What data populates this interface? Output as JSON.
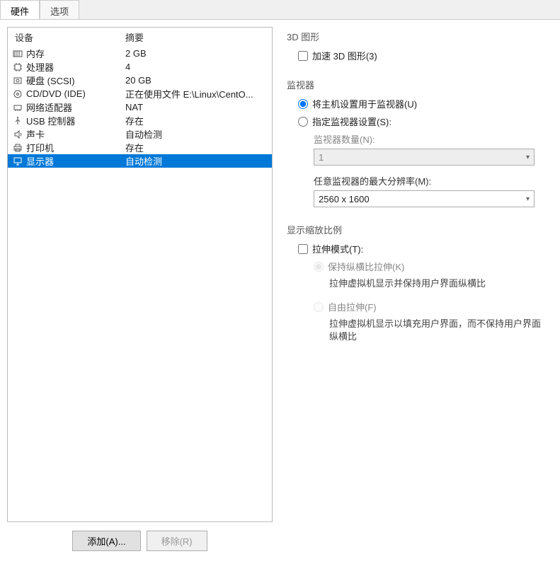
{
  "tabs": {
    "hardware": "硬件",
    "options": "选项"
  },
  "headers": {
    "device": "设备",
    "summary": "摘要"
  },
  "devices": [
    {
      "name": "内存",
      "summary": "2 GB"
    },
    {
      "name": "处理器",
      "summary": "4"
    },
    {
      "name": "硬盘 (SCSI)",
      "summary": "20 GB"
    },
    {
      "name": "CD/DVD (IDE)",
      "summary": "正在使用文件 E:\\Linux\\CentO..."
    },
    {
      "name": "网络适配器",
      "summary": "NAT"
    },
    {
      "name": "USB 控制器",
      "summary": "存在"
    },
    {
      "name": "声卡",
      "summary": "自动检测"
    },
    {
      "name": "打印机",
      "summary": "存在"
    },
    {
      "name": "显示器",
      "summary": "自动检测"
    }
  ],
  "buttons": {
    "add": "添加(A)...",
    "remove": "移除(R)"
  },
  "groups": {
    "g3d": {
      "title": "3D 图形",
      "accelerate": "加速 3D 图形(3)"
    },
    "monitor": {
      "title": "监视器",
      "useHost": "将主机设置用于监视器(U)",
      "specify": "指定监视器设置(S):",
      "countLabel": "监视器数量(N):",
      "countValue": "1",
      "maxResLabel": "任意监视器的最大分辨率(M):",
      "maxResValue": "2560 x 1600"
    },
    "scaling": {
      "title": "显示缩放比例",
      "stretchMode": "拉伸模式(T):",
      "keepAspect": "保持纵横比拉伸(K)",
      "keepAspectDesc": "拉伸虚拟机显示并保持用户界面纵横比",
      "free": "自由拉伸(F)",
      "freeDesc": "拉伸虚拟机显示以填充用户界面，而不保持用户界面纵横比"
    }
  }
}
